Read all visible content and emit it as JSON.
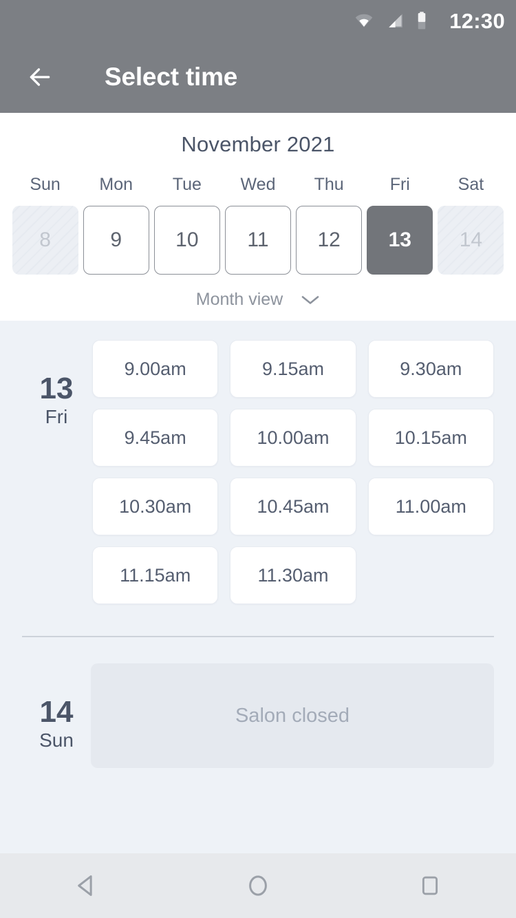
{
  "status_bar": {
    "time": "12:30",
    "icons": [
      "wifi-icon",
      "cell-signal-icon",
      "battery-icon"
    ]
  },
  "app_bar": {
    "back_icon": "arrow-left-icon",
    "title": "Select time",
    "background_color": "#7c7f84",
    "text_color": "#ffffff"
  },
  "calendar": {
    "month_title": "November 2021",
    "weekdays": [
      "Sun",
      "Mon",
      "Tue",
      "Wed",
      "Thu",
      "Fri",
      "Sat"
    ],
    "days": [
      {
        "number": "8",
        "state": "disabled"
      },
      {
        "number": "9",
        "state": "enabled"
      },
      {
        "number": "10",
        "state": "enabled"
      },
      {
        "number": "11",
        "state": "enabled"
      },
      {
        "number": "12",
        "state": "enabled"
      },
      {
        "number": "13",
        "state": "selected"
      },
      {
        "number": "14",
        "state": "disabled"
      }
    ],
    "view_switch": {
      "label": "Month view",
      "icon": "chevron-down-icon"
    },
    "selected_color": "#72757a",
    "title_color": "#4b5568"
  },
  "schedule": [
    {
      "day_number": "13",
      "day_name": "Fri",
      "slots": [
        "9.00am",
        "9.15am",
        "9.30am",
        "9.45am",
        "10.00am",
        "10.15am",
        "10.30am",
        "10.45am",
        "11.00am",
        "11.15am",
        "11.30am"
      ]
    },
    {
      "day_number": "14",
      "day_name": "Sun",
      "closed_message": "Salon closed"
    }
  ],
  "nav_bar": {
    "back_icon": "triangle-back-icon",
    "home_icon": "circle-home-icon",
    "recents_icon": "square-recents-icon",
    "background_color": "#e7e9ec"
  }
}
